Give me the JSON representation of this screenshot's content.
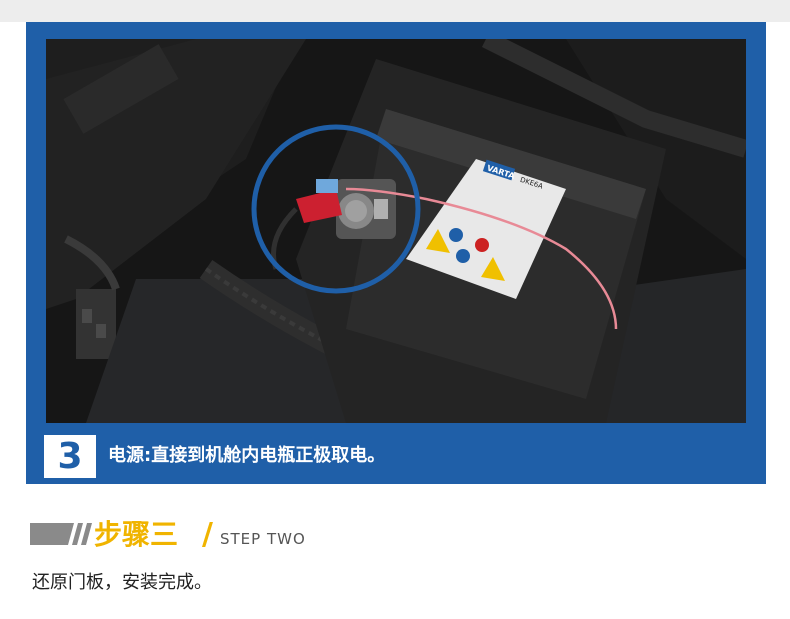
{
  "photo": {
    "step_number": "3",
    "caption": "电源:直接到机舱内电瓶正极取电。",
    "battery_brand": "VARTA",
    "battery_model": "DKE6A"
  },
  "step": {
    "title_cn": "步骤三",
    "separator": "/",
    "title_en": "STEP TWO"
  },
  "instruction": "还原门板，安装完成。",
  "colors": {
    "frame_blue": "#1f5fa8",
    "accent_yellow": "#f0b400",
    "bar_gray": "#8a8a8a"
  }
}
